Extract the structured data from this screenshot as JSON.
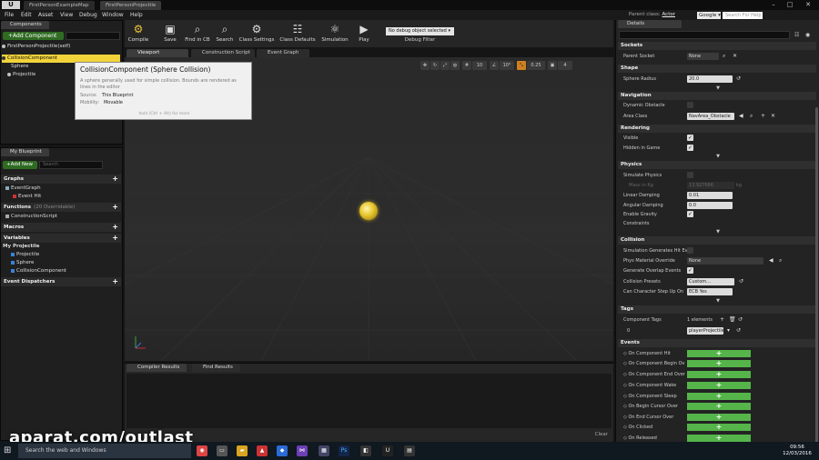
{
  "window": {
    "tabs": [
      "FirstPersonExampleMap",
      "FirstPersonProjectile"
    ],
    "parent_class_label": "Parent class:",
    "parent_class_value": "Actor",
    "search_engine": "Google",
    "help_placeholder": "Search For Help"
  },
  "menu": [
    "File",
    "Edit",
    "Asset",
    "View",
    "Debug",
    "Window",
    "Help"
  ],
  "components": {
    "tab": "Components",
    "add_label": "+Add Component",
    "self_item": "FirstPersonProjectile(self)",
    "tree": [
      "CollisionComponent",
      "Sphere",
      "Projectile"
    ]
  },
  "tooltip": {
    "title": "CollisionComponent (Sphere Collision)",
    "description": "A sphere generally used for simple collision. Bounds are rendered as lines in the editor",
    "source_label": "Source:",
    "source_value": "This Blueprint",
    "mobility_label": "Mobility:",
    "mobility_value": "Movable",
    "hint": "hold (Ctrl + Alt) for more"
  },
  "my_blueprint": {
    "tab": "My Blueprint",
    "add_label": "+Add New",
    "search_placeholder": "Search",
    "graphs_label": "Graphs",
    "graphs": [
      "EventGraph",
      "Event Hit"
    ],
    "functions_label": "Functions",
    "functions_sub": "(20 Overridable)",
    "functions": [
      "ConstructionScript"
    ],
    "macros_label": "Macros",
    "variables_label": "Variables",
    "variables_group": "My Projectile",
    "variables": [
      "Projectile",
      "Sphere",
      "CollisionComponent"
    ],
    "dispatchers_label": "Event Dispatchers"
  },
  "toolbar": {
    "buttons": [
      "Compile",
      "Save",
      "Find in CB",
      "Search",
      "Class Settings",
      "Class Defaults",
      "Simulation",
      "Play"
    ],
    "debug_value": "No debug object selected",
    "debug_label": "Debug Filter"
  },
  "editor_tabs": [
    "Viewport",
    "Construction Script",
    "Event Graph"
  ],
  "viewport": {
    "tools": [
      "10",
      "10°",
      "0.25",
      "4"
    ]
  },
  "bottom_tabs": [
    "Compiler Results",
    "Find Results"
  ],
  "bottom_clear": "Clear",
  "details": {
    "tab": "Details",
    "sockets_head": "Sockets",
    "parent_socket_label": "Parent Socket",
    "parent_socket_value": "None",
    "shape_head": "Shape",
    "sphere_radius_label": "Sphere Radius",
    "sphere_radius_value": "20.0",
    "navigation_head": "Navigation",
    "dynamic_obstacle_label": "Dynamic Obstacle",
    "area_class_label": "Area Class",
    "area_class_value": "NavArea_Obstacle",
    "rendering_head": "Rendering",
    "visible_label": "Visible",
    "hidden_label": "Hidden in Game",
    "physics_head": "Physics",
    "simulate_label": "Simulate Physics",
    "mass_label": "Mass in Kg",
    "mass_value": "13.927686",
    "mass_unit": "kg",
    "linear_label": "Linear Damping",
    "linear_value": "0.01",
    "angular_label": "Angular Damping",
    "angular_value": "0.0",
    "gravity_label": "Enable Gravity",
    "constraints_label": "Constraints",
    "collision_head": "Collision",
    "sim_hit_label": "Simulation Generates Hit Ev",
    "phys_mat_label": "Phys Material Override",
    "phys_mat_value": "None",
    "overlap_label": "Generate Overlap Events",
    "presets_label": "Collision Presets",
    "presets_value": "Custom...",
    "step_up_label": "Can Character Step Up On",
    "step_up_value": "ECB Yes",
    "tags_head": "Tags",
    "component_tags_label": "Component Tags",
    "component_tags_count": "1 elements",
    "tag_index": "0",
    "tag_value": "playerProjectile",
    "events_head": "Events",
    "events": [
      "On Component Hit",
      "On Component Begin Ov",
      "On Component End Over",
      "On Component Wake",
      "On Component Sleep",
      "On Begin Cursor Over",
      "On End Cursor Over",
      "On Clicked",
      "On Released"
    ]
  },
  "watermark": "aparat.com/outlast",
  "taskbar": {
    "search_placeholder": "Search the web and Windows",
    "time": "09:56",
    "date": "12/03/2016"
  }
}
